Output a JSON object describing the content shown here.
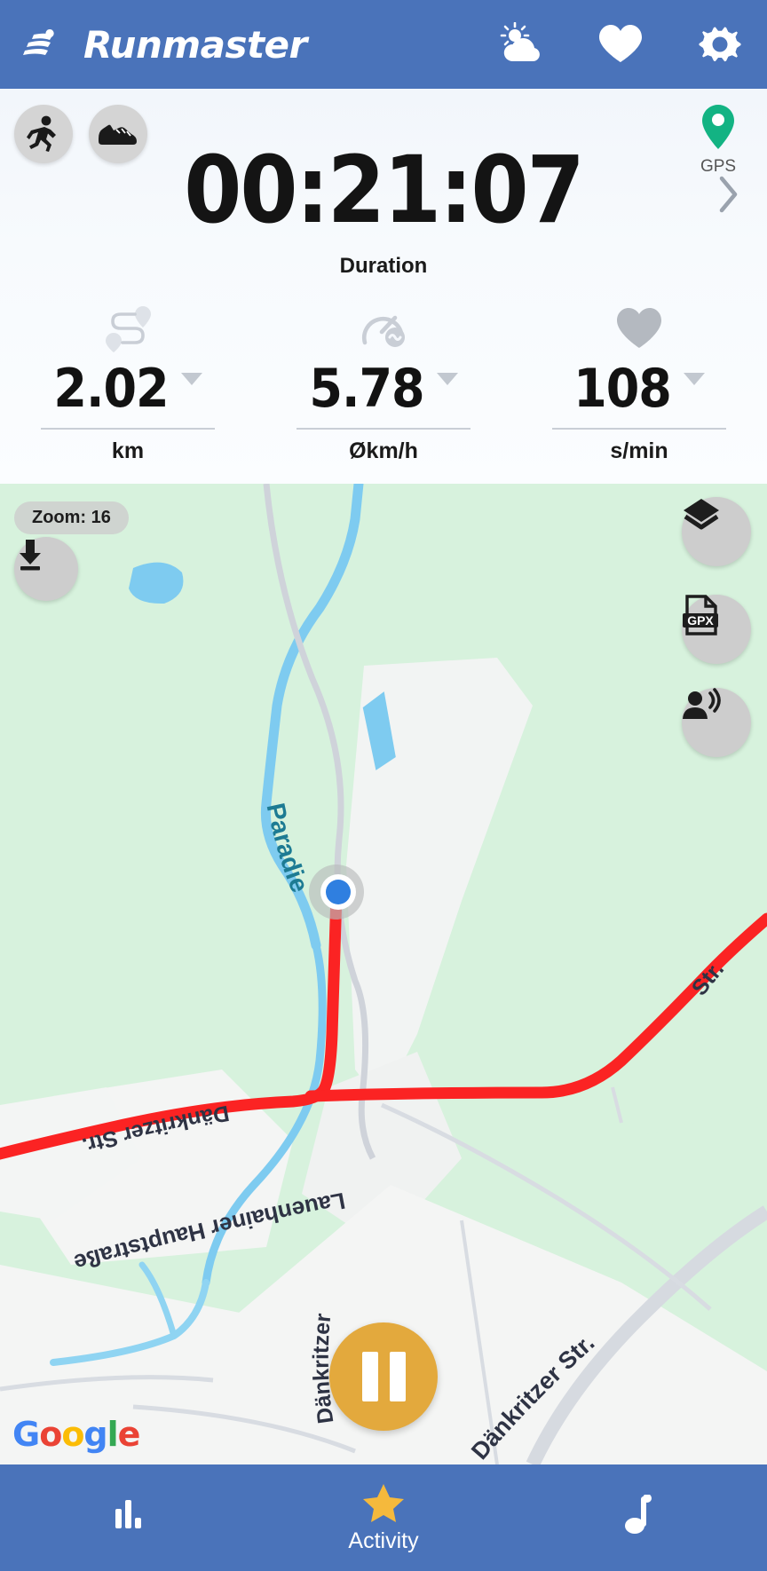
{
  "header": {
    "brand_title": "Runmaster",
    "brand_icon": "running-logo-icon",
    "actions": [
      {
        "name": "weather-icon",
        "label": "Weather"
      },
      {
        "name": "heart-icon",
        "label": "Heart rate"
      },
      {
        "name": "gear-icon",
        "label": "Settings"
      }
    ],
    "background_color": "#4a73ba"
  },
  "stats": {
    "mode_buttons": [
      {
        "name": "activity-running-icon",
        "label": "Running"
      },
      {
        "name": "shoe-icon",
        "label": "Shoe"
      }
    ],
    "gps": {
      "label": "GPS",
      "icon": "location-pin-icon",
      "color": "#13b383"
    },
    "duration": {
      "value": "00:21:07",
      "label": "Duration"
    },
    "expand_chevron": "chevron-right-icon",
    "metrics": [
      {
        "icon": "route-icon",
        "value": "2.02",
        "unit": "km",
        "caret": "caret-down-icon"
      },
      {
        "icon": "speed-icon",
        "value": "5.78",
        "unit": "Økm/h",
        "caret": "caret-down-icon"
      },
      {
        "icon": "heart-icon",
        "value": "108",
        "unit": "s/min",
        "caret": "caret-down-icon"
      }
    ]
  },
  "map": {
    "zoom_badge": "Zoom: 16",
    "attribution": "Google",
    "attribution_letters": [
      "G",
      "o",
      "o",
      "g",
      "l",
      "e"
    ],
    "left_buttons": [
      {
        "name": "download-icon",
        "label": "Download map"
      }
    ],
    "right_buttons": [
      {
        "name": "layers-icon",
        "label": "Map layers"
      },
      {
        "name": "gpx-file-icon",
        "label": "GPX",
        "text": "GPX"
      },
      {
        "name": "voice-coach-icon",
        "label": "Voice output"
      }
    ],
    "labels": [
      {
        "text": "Paradiesbach",
        "type": "water"
      },
      {
        "text": "Dänkritzer Str.",
        "type": "street"
      },
      {
        "text": "Dänkritzer Str.",
        "type": "street"
      },
      {
        "text": "Dänkritzer Str.",
        "type": "street"
      },
      {
        "text": "Lauenhainer Hauptstraße",
        "type": "street"
      }
    ],
    "track_color": "#fb2323",
    "position_marker": {
      "name": "current-position-dot",
      "color": "#2f7fe0"
    },
    "pause_button": {
      "name": "pause-button",
      "color": "#e3a93d"
    },
    "land_color": "#d7f2dd",
    "road_color": "#f4f4f4",
    "water_color": "#7ecbf0"
  },
  "bottom_nav": {
    "items": [
      {
        "name": "tab-statistics",
        "icon": "bar-chart-icon",
        "label": ""
      },
      {
        "name": "tab-activity",
        "icon": "star-icon",
        "label": "Activity",
        "active": true,
        "icon_color": "#f5b93c"
      },
      {
        "name": "tab-music",
        "icon": "music-note-icon",
        "label": ""
      }
    ],
    "background_color": "#4a73ba"
  }
}
